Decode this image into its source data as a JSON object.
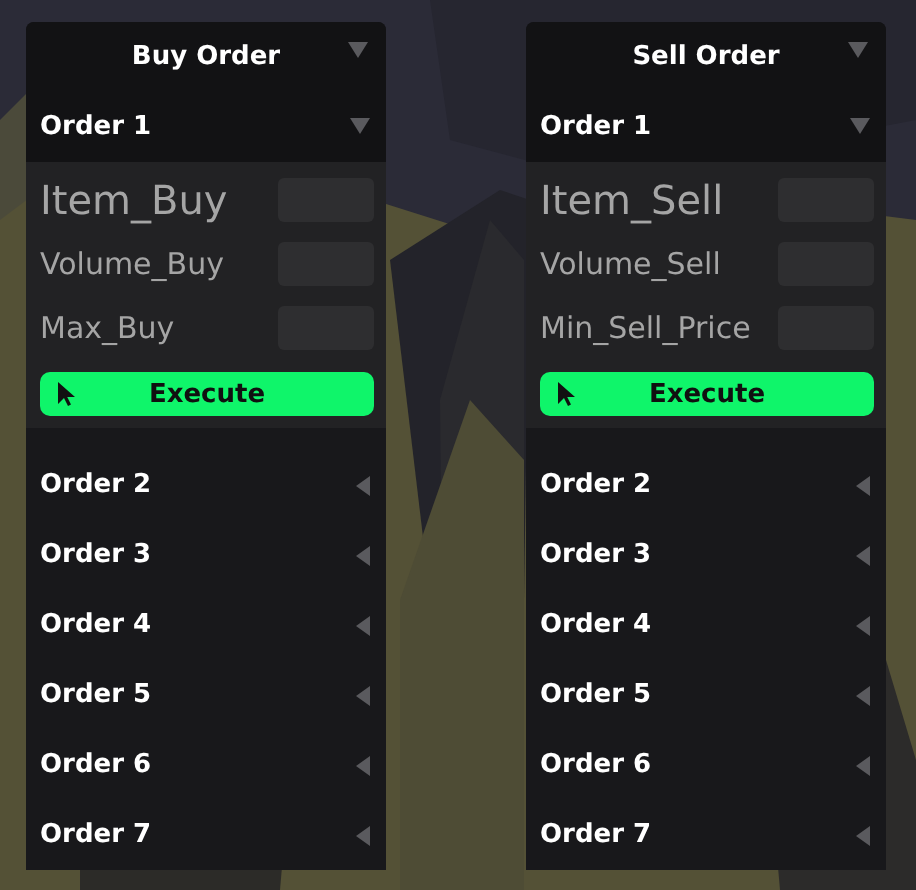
{
  "panels": [
    {
      "title": "Buy Order",
      "orders": [
        {
          "label": "Order 1",
          "expanded": true,
          "fields": [
            {
              "label": "Item_Buy",
              "kind": "large"
            },
            {
              "label": "Volume_Buy",
              "kind": "normal"
            },
            {
              "label": "Max_Buy",
              "kind": "normal"
            }
          ],
          "button": "Execute"
        },
        {
          "label": "Order 2",
          "expanded": false
        },
        {
          "label": "Order 3",
          "expanded": false
        },
        {
          "label": "Order 4",
          "expanded": false
        },
        {
          "label": "Order 5",
          "expanded": false
        },
        {
          "label": "Order 6",
          "expanded": false
        },
        {
          "label": "Order 7",
          "expanded": false
        }
      ]
    },
    {
      "title": "Sell Order",
      "orders": [
        {
          "label": "Order 1",
          "expanded": true,
          "fields": [
            {
              "label": "Item_Sell",
              "kind": "large"
            },
            {
              "label": "Volume_Sell",
              "kind": "normal"
            },
            {
              "label": "Min_Sell_Price",
              "kind": "normal"
            }
          ],
          "button": "Execute"
        },
        {
          "label": "Order 2",
          "expanded": false
        },
        {
          "label": "Order 3",
          "expanded": false
        },
        {
          "label": "Order 4",
          "expanded": false
        },
        {
          "label": "Order 5",
          "expanded": false
        },
        {
          "label": "Order 6",
          "expanded": false
        },
        {
          "label": "Order 7",
          "expanded": false
        }
      ]
    }
  ]
}
